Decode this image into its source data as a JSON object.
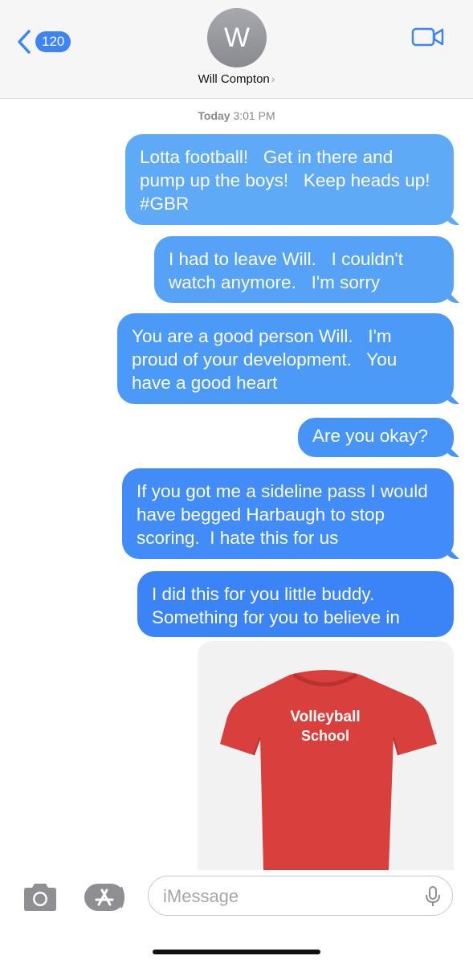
{
  "header": {
    "back_badge": "120",
    "avatar_initial": "W",
    "contact_name": "Will Compton",
    "contact_chevron": "›"
  },
  "timestamp": {
    "day": "Today",
    "time": "3:01 PM"
  },
  "messages": [
    {
      "text": "Lotta football!   Get in there and pump up the boys!   Keep heads up!  #GBR"
    },
    {
      "text": "I had to leave Will.   I couldn't watch anymore.   I'm sorry"
    },
    {
      "text": "You are a good person Will.   I'm proud of your development.   You have a good heart"
    },
    {
      "text": "Are you okay?"
    },
    {
      "text": "If you got me a sideline pass I would have begged Harbaugh to stop scoring.  I hate this for us"
    },
    {
      "text": "I did this for you little buddy.  Something for you to believe in"
    }
  ],
  "attachment": {
    "shirt_line1": "Volleyball",
    "shirt_line2": "School",
    "shirt_color": "#d9403d"
  },
  "composer": {
    "placeholder": "iMessage"
  },
  "colors": {
    "accent": "#3d84f7",
    "bubble_top": "#5eaaf7",
    "bubble_bottom": "#3b84f7"
  }
}
